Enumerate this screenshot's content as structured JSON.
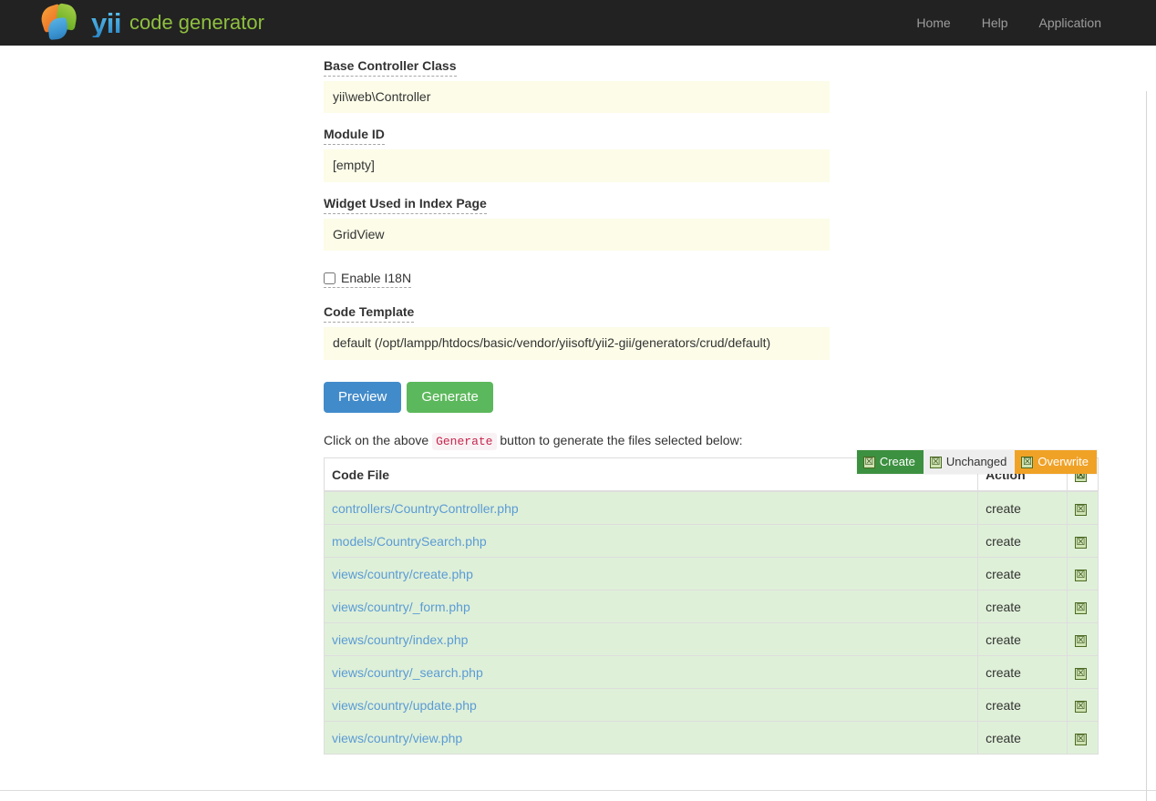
{
  "navbar": {
    "brand_primary": "yii",
    "brand_secondary": "code generator",
    "links": [
      {
        "label": "Home"
      },
      {
        "label": "Help"
      },
      {
        "label": "Application"
      }
    ],
    "colors": {
      "background": "#222222",
      "link": "#9d9d9d",
      "brand_yii": "#3b98d4",
      "brand_sub": "#8fc03f"
    }
  },
  "form": {
    "fields": [
      {
        "label": "Base Controller Class",
        "value": "yii\\web\\Controller"
      },
      {
        "label": "Module ID",
        "value": "[empty]"
      },
      {
        "label": "Widget Used in Index Page",
        "value": "GridView"
      }
    ],
    "checkbox": {
      "label": "Enable I18N",
      "checked": false
    },
    "template_field": {
      "label": "Code Template",
      "value": "default (/opt/lampp/htdocs/basic/vendor/yiisoft/yii2-gii/generators/crud/default)"
    },
    "buttons": {
      "preview": "Preview",
      "generate": "Generate"
    },
    "colors": {
      "input_background": "#fcfce8",
      "preview_button": "#428bca",
      "generate_button": "#5cb85c"
    }
  },
  "hint": {
    "prefix": "Click on the above",
    "code": "Generate",
    "suffix": "button to generate the files selected below:"
  },
  "legend": {
    "items": [
      {
        "label": "Create",
        "icon": "broken-image-icon",
        "color": "#3c9140"
      },
      {
        "label": "Unchanged",
        "icon": "broken-image-icon",
        "color": "#eeeeee"
      },
      {
        "label": "Overwrite",
        "icon": "broken-image-icon",
        "color": "#f0a227"
      }
    ]
  },
  "files_table": {
    "columns": {
      "file": "Code File",
      "action": "Action",
      "check": ""
    },
    "header_check_icon": "broken-image-icon",
    "rows": [
      {
        "file": "controllers/CountryController.php",
        "action": "create",
        "status": "create",
        "checked": true
      },
      {
        "file": "models/CountrySearch.php",
        "action": "create",
        "status": "create",
        "checked": true
      },
      {
        "file": "views/country/create.php",
        "action": "create",
        "status": "create",
        "checked": true
      },
      {
        "file": "views/country/_form.php",
        "action": "create",
        "status": "create",
        "checked": true
      },
      {
        "file": "views/country/index.php",
        "action": "create",
        "status": "create",
        "checked": true
      },
      {
        "file": "views/country/_search.php",
        "action": "create",
        "status": "create",
        "checked": true
      },
      {
        "file": "views/country/update.php",
        "action": "create",
        "status": "create",
        "checked": true
      },
      {
        "file": "views/country/view.php",
        "action": "create",
        "status": "create",
        "checked": true
      }
    ],
    "row_color_create": "#dff0d8",
    "link_color": "#5a9bd5"
  }
}
